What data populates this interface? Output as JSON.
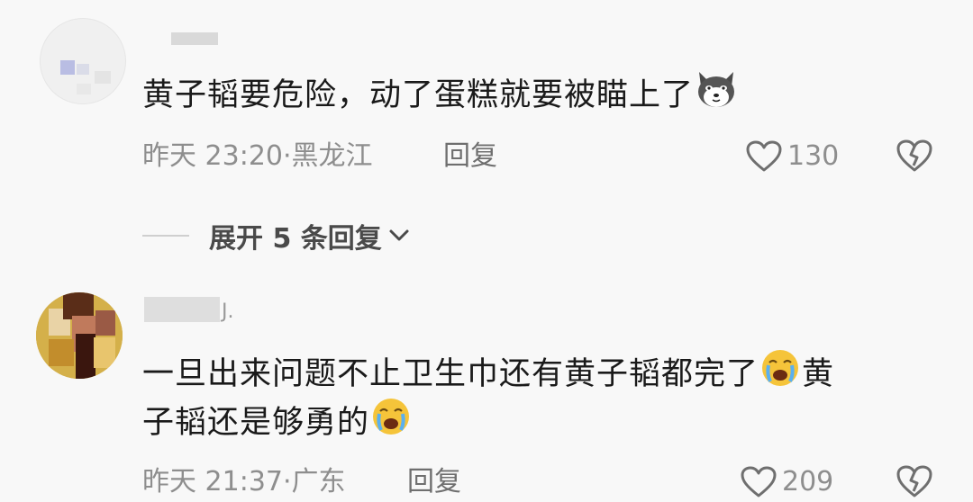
{
  "comments": [
    {
      "text_main": "黄子韬要危险，动了蛋糕就要被瞄上了",
      "time": "昨天 23:20",
      "location": "黑龙江",
      "reply_label": "回复",
      "likes": "130",
      "emoji": "husky-emoji"
    },
    {
      "name_tail": "J.",
      "text_line1": "一旦出来问题不止卫生巾还有黄子韬都完了",
      "text_line1_after": "黄",
      "text_line2": "子韬还是够勇的",
      "time": "昨天 21:37",
      "location": "广东",
      "reply_label": "回复",
      "likes": "209",
      "emoji": "crying-emoji"
    }
  ],
  "expand_replies": "展开 5 条回复",
  "colors": {
    "background": "#f8f8f8",
    "text": "#1a1a1a",
    "meta": "#8e8e8e"
  }
}
